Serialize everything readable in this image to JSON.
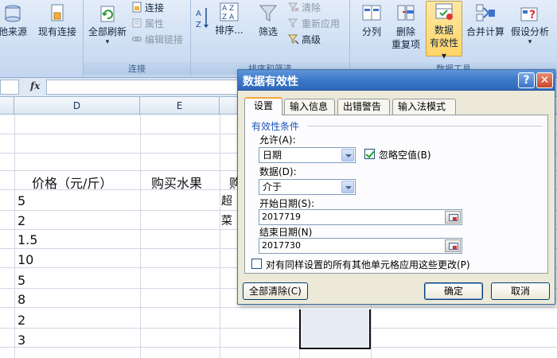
{
  "ribbon": {
    "get_external_data": "他来源",
    "existing_connections": "现有连接",
    "refresh_all": "全部刷新",
    "connections": "连接",
    "properties": "属性",
    "edit_links": "编辑链接",
    "connections_group": "连接",
    "sort_az": "A Z",
    "sort": "排序...",
    "filter": "筛选",
    "clear": "清除",
    "reapply": "重新应用",
    "advanced": "高级",
    "sort_filter_group": "排序和筛选",
    "text_to_columns": "分列",
    "remove_duplicates_1": "删除",
    "remove_duplicates_2": "重复项",
    "data_validation_1": "数据",
    "data_validation_2": "有效性 ▾",
    "consolidate": "合并计算",
    "what_if_1": "假设分析",
    "data_tools_group": "数据工具"
  },
  "formula_bar": {
    "fx": "fx",
    "value": ""
  },
  "columns": {
    "D": "D",
    "E": "E"
  },
  "sheet": {
    "header_price": "价格（元/斤）",
    "header_fruit": "购买水果",
    "header_partial": "购",
    "partial_1": "超",
    "partial_2": "菜",
    "prices": [
      "5",
      "2",
      "1.5",
      "10",
      "5",
      "8",
      "2",
      "3"
    ]
  },
  "dialog": {
    "title": "数据有效性",
    "help": "?",
    "close": "✕",
    "tabs": [
      "设置",
      "输入信息",
      "出错警告",
      "输入法模式"
    ],
    "group_label": "有效性条件",
    "allow_label": "允许(A):",
    "allow_value": "日期",
    "ignore_blank": "忽略空值(B)",
    "data_label": "数据(D):",
    "data_value": "介于",
    "start_label": "开始日期(S):",
    "start_value": "2017719",
    "end_label": "结束日期(N)",
    "end_value": "2017730",
    "apply_all": "对有同样设置的所有其他单元格应用这些更改(P)",
    "clear_all": "全部清除(C)",
    "ok": "确定",
    "cancel": "取消"
  }
}
